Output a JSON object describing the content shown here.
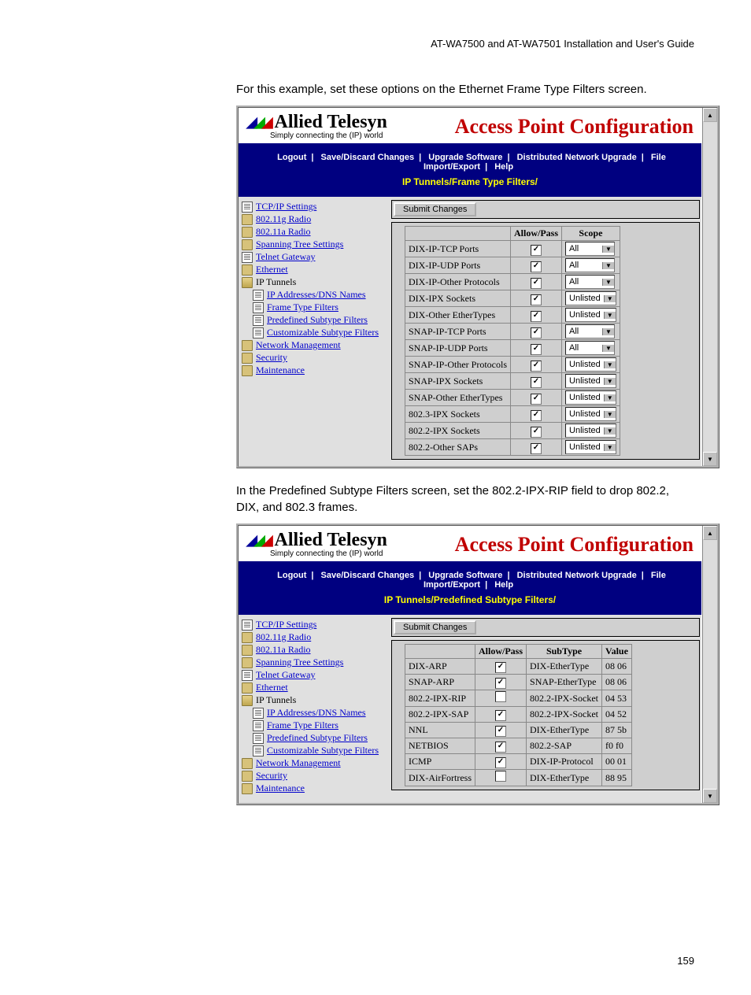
{
  "doc": {
    "header": "AT-WA7500 and AT-WA7501 Installation and User's Guide",
    "para1": "For this example, set these options on the Ethernet Frame Type Filters screen.",
    "para2": "In the Predefined Subtype Filters screen, set the 802.2-IPX-RIP field to drop 802.2, DIX, and 802.3 frames.",
    "page_number": "159"
  },
  "app": {
    "brand": "Allied Telesyn",
    "tagline": "Simply connecting the (IP) world",
    "title": "Access Point Configuration",
    "menu": {
      "logout": "Logout",
      "save": "Save/Discard Changes",
      "upgrade": "Upgrade Software",
      "dnu": "Distributed Network Upgrade",
      "file": "File Import/Export",
      "help": "Help"
    },
    "crumb1": "IP Tunnels/Frame Type Filters/",
    "crumb2": "IP Tunnels/Predefined Subtype Filters/",
    "submit_label": "Submit Changes",
    "sidebar": [
      {
        "label": "TCP/IP Settings",
        "icon": "doc",
        "indent": 0,
        "link": true
      },
      {
        "label": "802.11g Radio",
        "icon": "folder",
        "indent": 0,
        "link": true
      },
      {
        "label": "802.11a Radio",
        "icon": "folder",
        "indent": 0,
        "link": true
      },
      {
        "label": "Spanning Tree Settings",
        "icon": "folder",
        "indent": 0,
        "link": true
      },
      {
        "label": "Telnet Gateway",
        "icon": "doc",
        "indent": 0,
        "link": true
      },
      {
        "label": "Ethernet",
        "icon": "folder",
        "indent": 0,
        "link": true
      },
      {
        "label": "IP Tunnels",
        "icon": "folder open",
        "indent": 0,
        "link": false
      },
      {
        "label": "IP Addresses/DNS Names",
        "icon": "doc",
        "indent": 1,
        "link": true
      },
      {
        "label": "Frame Type Filters",
        "icon": "doc",
        "indent": 1,
        "link": true
      },
      {
        "label": "Predefined Subtype Filters",
        "icon": "doc",
        "indent": 1,
        "link": true
      },
      {
        "label": "Customizable Subtype Filters",
        "icon": "doc",
        "indent": 1,
        "link": true
      },
      {
        "label": "Network Management",
        "icon": "folder",
        "indent": 0,
        "link": true
      },
      {
        "label": "Security",
        "icon": "folder",
        "indent": 0,
        "link": true
      },
      {
        "label": "Maintenance",
        "icon": "folder",
        "indent": 0,
        "link": true
      }
    ]
  },
  "table1": {
    "headers": {
      "name": "",
      "allow": "Allow/Pass",
      "scope": "Scope"
    },
    "rows": [
      {
        "name": "DIX-IP-TCP Ports",
        "allow": true,
        "scope": "All"
      },
      {
        "name": "DIX-IP-UDP Ports",
        "allow": true,
        "scope": "All"
      },
      {
        "name": "DIX-IP-Other Protocols",
        "allow": true,
        "scope": "All"
      },
      {
        "name": "DIX-IPX Sockets",
        "allow": true,
        "scope": "Unlisted"
      },
      {
        "name": "DIX-Other EtherTypes",
        "allow": true,
        "scope": "Unlisted"
      },
      {
        "name": "SNAP-IP-TCP Ports",
        "allow": true,
        "scope": "All"
      },
      {
        "name": "SNAP-IP-UDP Ports",
        "allow": true,
        "scope": "All"
      },
      {
        "name": "SNAP-IP-Other Protocols",
        "allow": true,
        "scope": "Unlisted"
      },
      {
        "name": "SNAP-IPX Sockets",
        "allow": true,
        "scope": "Unlisted"
      },
      {
        "name": "SNAP-Other EtherTypes",
        "allow": true,
        "scope": "Unlisted"
      },
      {
        "name": "802.3-IPX Sockets",
        "allow": true,
        "scope": "Unlisted"
      },
      {
        "name": "802.2-IPX Sockets",
        "allow": true,
        "scope": "Unlisted"
      },
      {
        "name": "802.2-Other SAPs",
        "allow": true,
        "scope": "Unlisted"
      }
    ]
  },
  "table2": {
    "headers": {
      "name": "",
      "allow": "Allow/Pass",
      "subtype": "SubType",
      "value": "Value"
    },
    "rows": [
      {
        "name": "DIX-ARP",
        "allow": true,
        "subtype": "DIX-EtherType",
        "value": "08 06"
      },
      {
        "name": "SNAP-ARP",
        "allow": true,
        "subtype": "SNAP-EtherType",
        "value": "08 06"
      },
      {
        "name": "802.2-IPX-RIP",
        "allow": false,
        "subtype": "802.2-IPX-Socket",
        "value": "04 53"
      },
      {
        "name": "802.2-IPX-SAP",
        "allow": true,
        "subtype": "802.2-IPX-Socket",
        "value": "04 52"
      },
      {
        "name": "NNL",
        "allow": true,
        "subtype": "DIX-EtherType",
        "value": "87 5b"
      },
      {
        "name": "NETBIOS",
        "allow": true,
        "subtype": "802.2-SAP",
        "value": "f0 f0"
      },
      {
        "name": "ICMP",
        "allow": true,
        "subtype": "DIX-IP-Protocol",
        "value": "00 01"
      },
      {
        "name": "DIX-AirFortress",
        "allow": false,
        "subtype": "DIX-EtherType",
        "value": "88 95"
      }
    ]
  }
}
